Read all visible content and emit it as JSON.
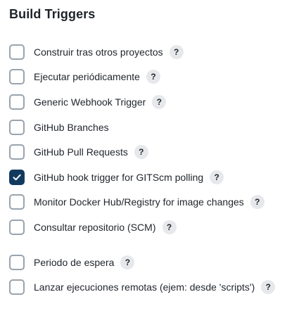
{
  "section": {
    "title": "Build Triggers"
  },
  "help_glyph": "?",
  "colors": {
    "checkbox_border": "#9aa3ad",
    "checkbox_checked": "#123a5e",
    "help_bg": "#e6e8eb"
  },
  "triggers": [
    {
      "label": "Construir tras otros proyectos",
      "checked": false,
      "has_help": true
    },
    {
      "label": "Ejecutar periódicamente",
      "checked": false,
      "has_help": true
    },
    {
      "label": "Generic Webhook Trigger",
      "checked": false,
      "has_help": true
    },
    {
      "label": "GitHub Branches",
      "checked": false,
      "has_help": false
    },
    {
      "label": "GitHub Pull Requests",
      "checked": false,
      "has_help": true
    },
    {
      "label": "GitHub hook trigger for GITScm polling",
      "checked": true,
      "has_help": true
    },
    {
      "label": "Monitor Docker Hub/Registry for image changes",
      "checked": false,
      "has_help": true
    },
    {
      "label": "Consultar repositorio (SCM)",
      "checked": false,
      "has_help": true
    },
    {
      "label": "Periodo de espera",
      "checked": false,
      "has_help": true
    },
    {
      "label": "Lanzar ejecuciones remotas (ejem: desde 'scripts')",
      "checked": false,
      "has_help": true
    }
  ]
}
